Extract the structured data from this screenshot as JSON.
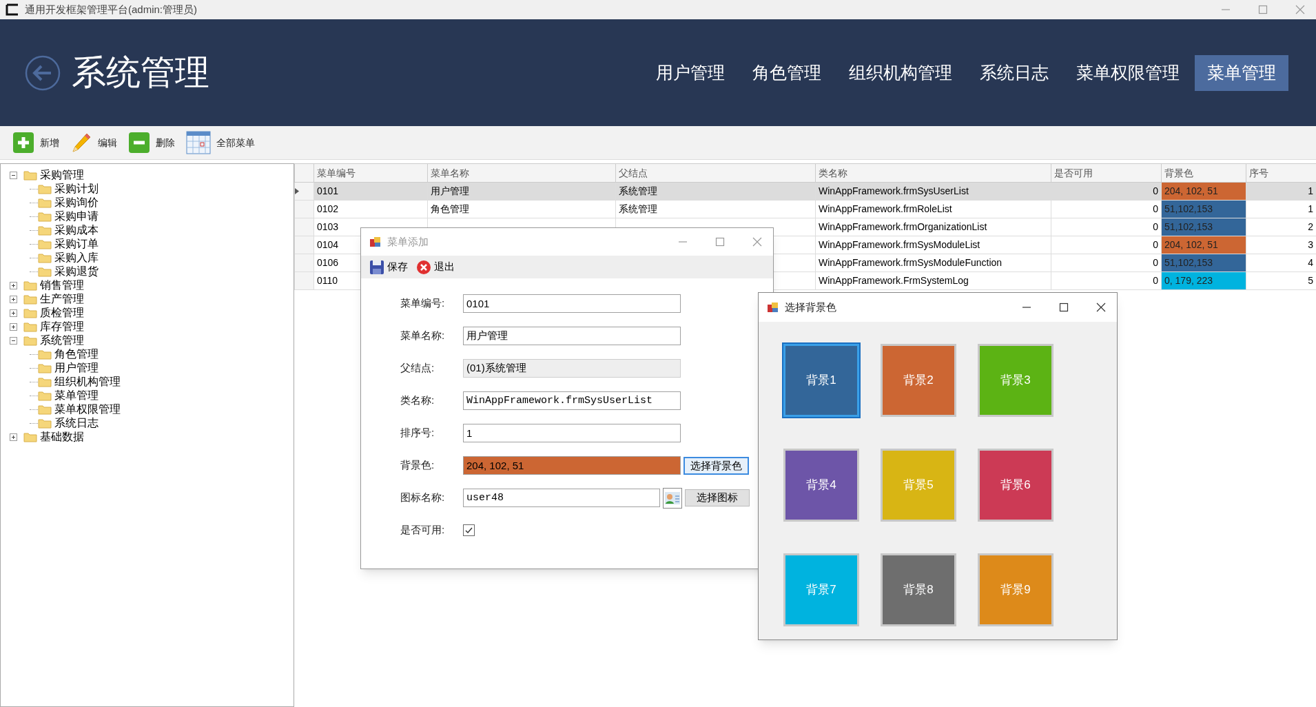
{
  "window": {
    "title": "通用开发框架管理平台(admin:管理员)"
  },
  "header": {
    "title": "系统管理",
    "nav": [
      {
        "label": "用户管理",
        "selected": false
      },
      {
        "label": "角色管理",
        "selected": false
      },
      {
        "label": "组织机构管理",
        "selected": false
      },
      {
        "label": "系统日志",
        "selected": false
      },
      {
        "label": "菜单权限管理",
        "selected": false
      },
      {
        "label": "菜单管理",
        "selected": true
      }
    ]
  },
  "toolbar": [
    {
      "kind": "add",
      "label": "新增"
    },
    {
      "kind": "edit",
      "label": "编辑"
    },
    {
      "kind": "delete",
      "label": "删除"
    },
    {
      "kind": "all",
      "label": "全部菜单"
    }
  ],
  "tree": [
    {
      "label": "采购管理",
      "expanded": true,
      "children": [
        {
          "label": "采购计划"
        },
        {
          "label": "采购询价"
        },
        {
          "label": "采购申请"
        },
        {
          "label": "采购成本"
        },
        {
          "label": "采购订单"
        },
        {
          "label": "采购入库"
        },
        {
          "label": "采购退货"
        }
      ]
    },
    {
      "label": "销售管理",
      "expanded": false
    },
    {
      "label": "生产管理",
      "expanded": false
    },
    {
      "label": "质检管理",
      "expanded": false
    },
    {
      "label": "库存管理",
      "expanded": false
    },
    {
      "label": "系统管理",
      "expanded": true,
      "children": [
        {
          "label": "角色管理"
        },
        {
          "label": "用户管理"
        },
        {
          "label": "组织机构管理"
        },
        {
          "label": "菜单管理"
        },
        {
          "label": "菜单权限管理"
        },
        {
          "label": "系统日志"
        }
      ]
    },
    {
      "label": "基础数据",
      "expanded": false
    }
  ],
  "table": {
    "columns": [
      "菜单编号",
      "菜单名称",
      "父结点",
      "类名称",
      "是否可用",
      "背景色",
      "序号"
    ],
    "rows": [
      {
        "selected": true,
        "code": "0101",
        "name": "用户管理",
        "parent": "系统管理",
        "class_name": "WinAppFramework.frmSysUserList",
        "enabled": "0",
        "bg_text": "204, 102, 51",
        "color": "#cc6633",
        "order": "1"
      },
      {
        "selected": false,
        "code": "0102",
        "name": "角色管理",
        "parent": "系统管理",
        "class_name": "WinAppFramework.frmRoleList",
        "enabled": "0",
        "bg_text": "51,102,153",
        "color": "#336699",
        "order": "1"
      },
      {
        "selected": false,
        "code": "0103",
        "class_name": "WinAppFramework.frmOrganizationList",
        "enabled": "0",
        "bg_text": "51,102,153",
        "color": "#336699",
        "order": "2"
      },
      {
        "selected": false,
        "code": "0104",
        "class_name": "WinAppFramework.frmSysModuleList",
        "enabled": "0",
        "bg_text": "204, 102, 51",
        "color": "#cc6633",
        "order": "3"
      },
      {
        "selected": false,
        "code": "0106",
        "class_name": "WinAppFramework.frmSysModuleFunction",
        "enabled": "0",
        "bg_text": "51,102,153",
        "color": "#336699",
        "order": "4"
      },
      {
        "selected": false,
        "code": "0110",
        "class_name": "WinAppFramework.FrmSystemLog",
        "enabled": "0",
        "bg_text": "0, 179, 223",
        "color": "#00b3df",
        "order": "5"
      }
    ]
  },
  "menu_dialog": {
    "title": "菜单添加",
    "toolbar": [
      {
        "kind": "save",
        "label": "保存"
      },
      {
        "kind": "exit",
        "label": "退出"
      }
    ],
    "fields": [
      {
        "kind": "text",
        "label": "菜单编号:",
        "value": "0101"
      },
      {
        "kind": "text",
        "label": "菜单名称:",
        "value": "用户管理"
      },
      {
        "kind": "disabled",
        "label": "父结点:",
        "value": "(01)系统管理"
      },
      {
        "kind": "mono",
        "label": "类名称:",
        "value": "WinAppFramework.frmSysUserList"
      },
      {
        "kind": "text",
        "label": "排序号:",
        "value": "1"
      },
      {
        "kind": "color",
        "label": "背景色:",
        "value": "204, 102, 51",
        "color": "#cc6633",
        "button": "选择背景色"
      },
      {
        "kind": "icon",
        "label": "图标名称:",
        "value": "user48",
        "button": "选择图标"
      },
      {
        "kind": "checkbox",
        "label": "是否可用:",
        "checked": true
      }
    ]
  },
  "color_dialog": {
    "title": "选择背景色",
    "swatches": [
      {
        "label": "背景1",
        "color": "#336699",
        "selected": true
      },
      {
        "label": "背景2",
        "color": "#cc6633",
        "selected": false
      },
      {
        "label": "背景3",
        "color": "#5cb314",
        "selected": false
      },
      {
        "label": "背景4",
        "color": "#6d55a8",
        "selected": false
      },
      {
        "label": "背景5",
        "color": "#d8b514",
        "selected": false
      },
      {
        "label": "背景6",
        "color": "#cc3a55",
        "selected": false
      },
      {
        "label": "背景7",
        "color": "#00b3df",
        "selected": false
      },
      {
        "label": "背景8",
        "color": "#6e6e6e",
        "selected": false
      },
      {
        "label": "背景9",
        "color": "#dd8a1a",
        "selected": false
      }
    ]
  }
}
